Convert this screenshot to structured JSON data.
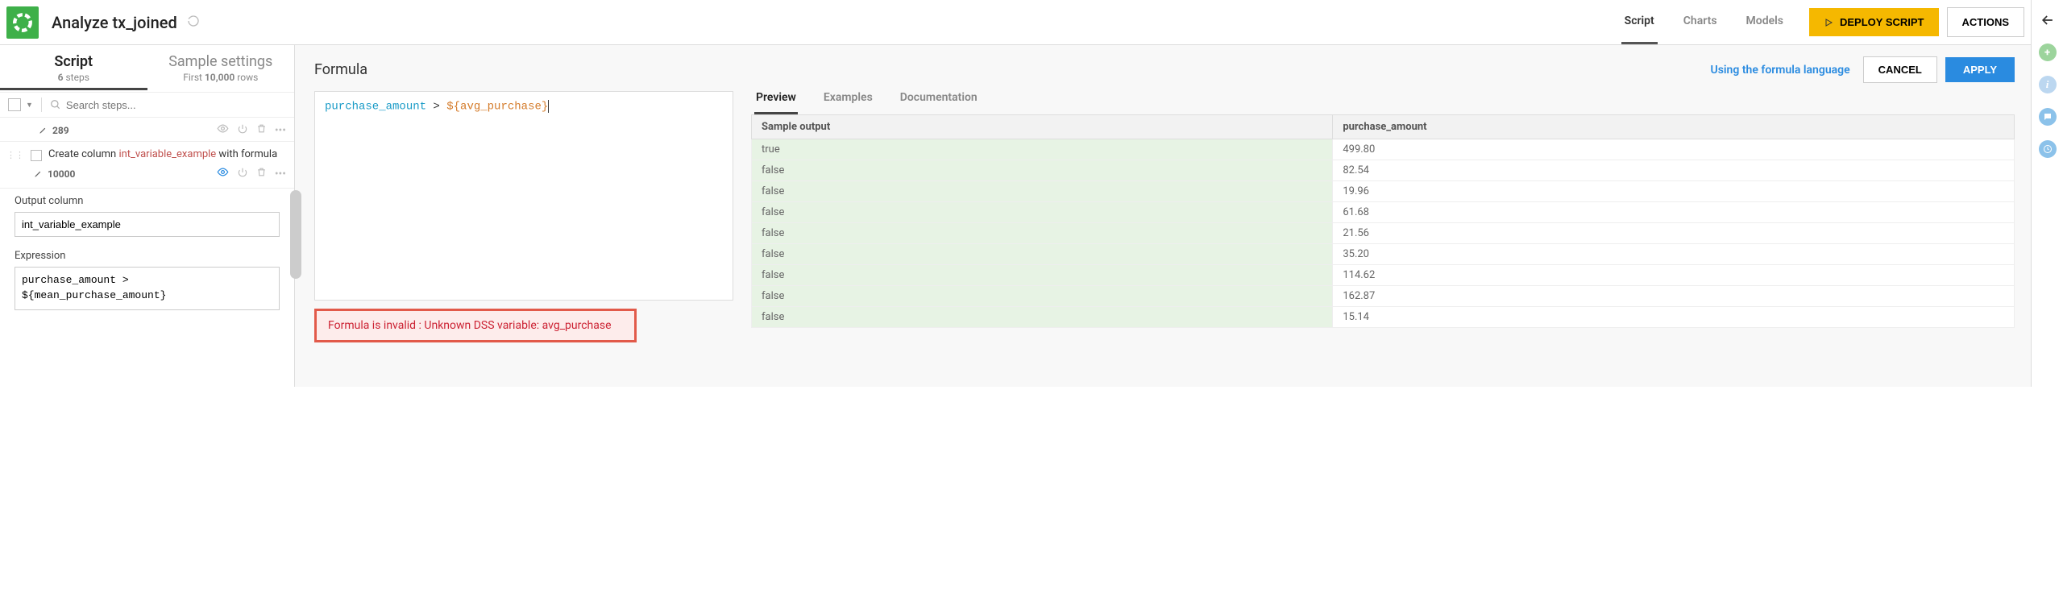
{
  "header": {
    "title": "Analyze tx_joined",
    "tabs": [
      "Script",
      "Charts",
      "Models"
    ],
    "active_tab": 0,
    "deploy_label": "DEPLOY SCRIPT",
    "actions_label": "ACTIONS"
  },
  "left": {
    "tabs": {
      "script": {
        "title": "Script",
        "sub_prefix": "6",
        "sub_suffix": " steps"
      },
      "sample": {
        "title": "Sample settings",
        "sub_prefix": "First ",
        "sub_strong": "10,000",
        "sub_suffix": " rows"
      }
    },
    "search_placeholder": "Search steps...",
    "step1_count": "289",
    "step2": {
      "text_prefix": "Create column ",
      "ref": "int_variable_example",
      "text_suffix": " with formula",
      "count": "10000"
    },
    "output_label": "Output column",
    "output_value": "int_variable_example",
    "expression_label": "Expression",
    "expression_value": "purchase_amount > ${mean_purchase_amount}"
  },
  "formula": {
    "title": "Formula",
    "link": "Using the formula language",
    "cancel": "CANCEL",
    "apply": "APPLY",
    "tok_field": "purchase_amount",
    "tok_op": " > ",
    "tok_var": "${avg_purchase}",
    "error": "Formula is invalid : Unknown DSS variable: avg_purchase"
  },
  "preview": {
    "tabs": [
      "Preview",
      "Examples",
      "Documentation"
    ],
    "active_tab": 0,
    "headers": [
      "Sample output",
      "purchase_amount"
    ],
    "rows": [
      [
        "true",
        "499.80"
      ],
      [
        "false",
        "82.54"
      ],
      [
        "false",
        "19.96"
      ],
      [
        "false",
        "61.68"
      ],
      [
        "false",
        "21.56"
      ],
      [
        "false",
        "35.20"
      ],
      [
        "false",
        "114.62"
      ],
      [
        "false",
        "162.87"
      ],
      [
        "false",
        "15.14"
      ]
    ]
  }
}
